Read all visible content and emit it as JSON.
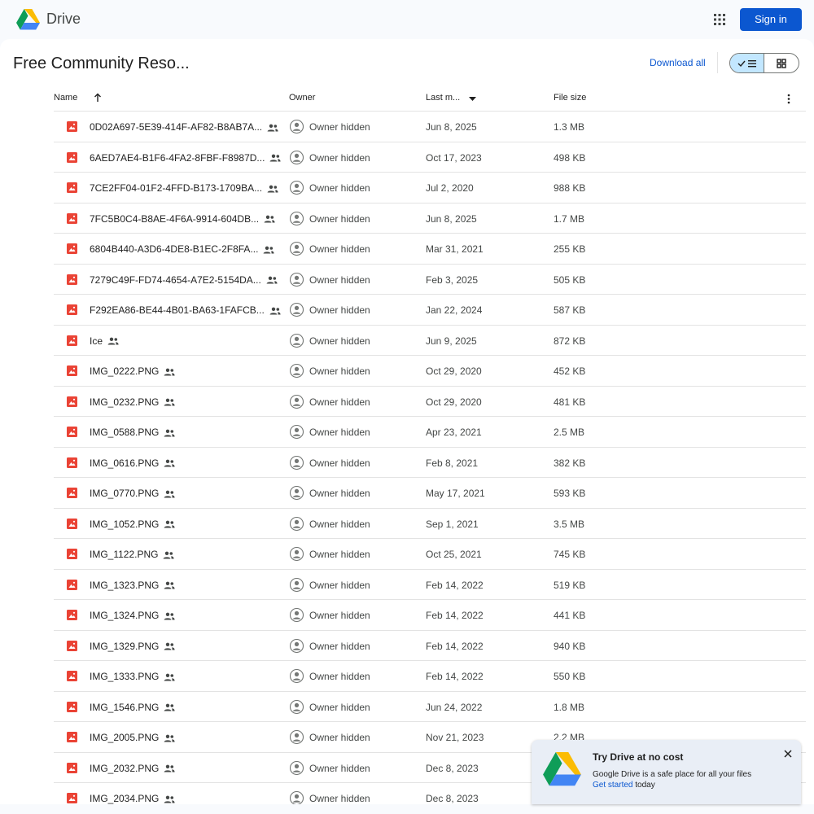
{
  "topbar": {
    "brand": "Drive",
    "logo_icon": "google-drive-logo",
    "apps_icon": "apps-grid-icon",
    "signin_label": "Sign in"
  },
  "folder": {
    "title": "Free Community Reso...",
    "download_all_label": "Download all",
    "view_toggle": {
      "list_icon": "check-list-icon",
      "grid_icon": "grid-icon",
      "selected": "list"
    }
  },
  "table": {
    "headers": {
      "name": "Name",
      "owner": "Owner",
      "modified": "Last m...",
      "size": "File size"
    },
    "sort": {
      "name": "ascending",
      "modified": "descending"
    },
    "rows": [
      {
        "name": "0D02A697-5E39-414F-AF82-B8AB7A...",
        "owner": "Owner hidden",
        "date": "Jun 8, 2025",
        "size": "1.3 MB"
      },
      {
        "name": "6AED7AE4-B1F6-4FA2-8FBF-F8987D...",
        "owner": "Owner hidden",
        "date": "Oct 17, 2023",
        "size": "498 KB"
      },
      {
        "name": "7CE2FF04-01F2-4FFD-B173-1709BA...",
        "owner": "Owner hidden",
        "date": "Jul 2, 2020",
        "size": "988 KB"
      },
      {
        "name": "7FC5B0C4-B8AE-4F6A-9914-604DB...",
        "owner": "Owner hidden",
        "date": "Jun 8, 2025",
        "size": "1.7 MB"
      },
      {
        "name": "6804B440-A3D6-4DE8-B1EC-2F8FA...",
        "owner": "Owner hidden",
        "date": "Mar 31, 2021",
        "size": "255 KB"
      },
      {
        "name": "7279C49F-FD74-4654-A7E2-5154DA...",
        "owner": "Owner hidden",
        "date": "Feb 3, 2025",
        "size": "505 KB"
      },
      {
        "name": "F292EA86-BE44-4B01-BA63-1FAFCB...",
        "owner": "Owner hidden",
        "date": "Jan 22, 2024",
        "size": "587 KB"
      },
      {
        "name": "Ice",
        "owner": "Owner hidden",
        "date": "Jun 9, 2025",
        "size": "872 KB"
      },
      {
        "name": "IMG_0222.PNG",
        "owner": "Owner hidden",
        "date": "Oct 29, 2020",
        "size": "452 KB"
      },
      {
        "name": "IMG_0232.PNG",
        "owner": "Owner hidden",
        "date": "Oct 29, 2020",
        "size": "481 KB"
      },
      {
        "name": "IMG_0588.PNG",
        "owner": "Owner hidden",
        "date": "Apr 23, 2021",
        "size": "2.5 MB"
      },
      {
        "name": "IMG_0616.PNG",
        "owner": "Owner hidden",
        "date": "Feb 8, 2021",
        "size": "382 KB"
      },
      {
        "name": "IMG_0770.PNG",
        "owner": "Owner hidden",
        "date": "May 17, 2021",
        "size": "593 KB"
      },
      {
        "name": "IMG_1052.PNG",
        "owner": "Owner hidden",
        "date": "Sep 1, 2021",
        "size": "3.5 MB"
      },
      {
        "name": "IMG_1122.PNG",
        "owner": "Owner hidden",
        "date": "Oct 25, 2021",
        "size": "745 KB"
      },
      {
        "name": "IMG_1323.PNG",
        "owner": "Owner hidden",
        "date": "Feb 14, 2022",
        "size": "519 KB"
      },
      {
        "name": "IMG_1324.PNG",
        "owner": "Owner hidden",
        "date": "Feb 14, 2022",
        "size": "441 KB"
      },
      {
        "name": "IMG_1329.PNG",
        "owner": "Owner hidden",
        "date": "Feb 14, 2022",
        "size": "940 KB"
      },
      {
        "name": "IMG_1333.PNG",
        "owner": "Owner hidden",
        "date": "Feb 14, 2022",
        "size": "550 KB"
      },
      {
        "name": "IMG_1546.PNG",
        "owner": "Owner hidden",
        "date": "Jun 24, 2022",
        "size": "1.8 MB"
      },
      {
        "name": "IMG_2005.PNG",
        "owner": "Owner hidden",
        "date": "Nov 21, 2023",
        "size": "2.2 MB"
      },
      {
        "name": "IMG_2032.PNG",
        "owner": "Owner hidden",
        "date": "Dec 8, 2023",
        "size": ""
      },
      {
        "name": "IMG_2034.PNG",
        "owner": "Owner hidden",
        "date": "Dec 8, 2023",
        "size": ""
      }
    ],
    "file_icon": "image-file-icon",
    "shared_icon": "shared-people-icon",
    "owner_avatar_icon": "avatar-placeholder-icon"
  },
  "promo": {
    "title": "Try Drive at no cost",
    "body": "Google Drive is a safe place for all your files",
    "link": "Get started",
    "suffix": " today",
    "close_icon": "close-icon"
  },
  "colors": {
    "accent": "#0b57d0",
    "file_icon_red": "#ea4335",
    "toggle_selected": "#c2e7ff",
    "promo_bg": "#e9eef6"
  }
}
